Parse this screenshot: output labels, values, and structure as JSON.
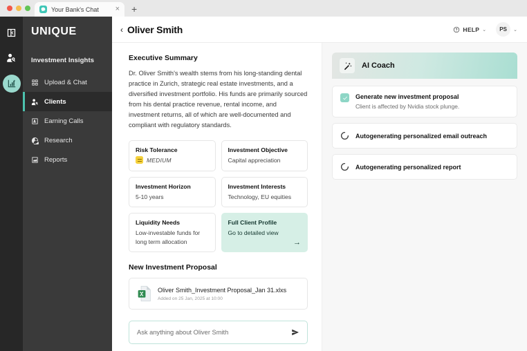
{
  "browser": {
    "tab_title": "Your Bank's Chat",
    "tab_close": "×",
    "new_tab": "+"
  },
  "rail": {
    "items": [
      {
        "icon": "panel-collapse-icon",
        "name": "collapse-panel"
      },
      {
        "icon": "user-search-icon",
        "name": "user-search"
      },
      {
        "icon": "insights-chart-icon",
        "name": "investment-insights",
        "active": true
      }
    ]
  },
  "sidebar": {
    "brand": "UNIQUE",
    "heading": "Investment Insights",
    "items": [
      {
        "label": "Upload & Chat",
        "icon": "grid-upload-icon",
        "active": false
      },
      {
        "label": "Clients",
        "icon": "clients-icon",
        "active": true
      },
      {
        "label": "Earning Calls",
        "icon": "earning-calls-icon",
        "active": false
      },
      {
        "label": "Research",
        "icon": "research-icon",
        "active": false
      },
      {
        "label": "Reports",
        "icon": "reports-icon",
        "active": false
      }
    ]
  },
  "topbar": {
    "back": "‹",
    "title": "Oliver Smith",
    "help_label": "HELP",
    "caret": "⌄",
    "avatar_initials": "PS"
  },
  "summary": {
    "title": "Executive Summary",
    "body": "Dr. Oliver Smith's wealth stems from his long-standing dental practice in Zurich, strategic real estate investments, and a diversified investment portfolio. His funds are primarily sourced from his dental practice revenue, rental income, and investment returns, all of which are well-documented and compliant with regulatory standards."
  },
  "cards": [
    {
      "label": "Risk Tolerance",
      "value": "MEDIUM",
      "badge": true,
      "accent": false
    },
    {
      "label": "Investment Objective",
      "value": "Capital appreciation",
      "badge": false,
      "accent": false
    },
    {
      "label": "Investment Horizon",
      "value": "5-10 years",
      "badge": false,
      "accent": false
    },
    {
      "label": "Investment Interests",
      "value": "Technology, EU equities",
      "badge": false,
      "accent": false
    },
    {
      "label": "Liquidity Needs",
      "value": "Low-investable funds for long term allocation",
      "badge": false,
      "accent": false
    },
    {
      "label": "Full Client Profile",
      "value": "Go to detailed view",
      "badge": false,
      "accent": true,
      "arrow": "→"
    }
  ],
  "proposal": {
    "title": "New Investment Proposal",
    "file_name": "Oliver Smith_Investment Proposal_Jan 31.xlxs",
    "file_meta": "Added on 25 Jan, 2025 at 10:00",
    "file_icon": "excel-file-icon"
  },
  "chat": {
    "placeholder": "Ask anything about Oliver Smith",
    "send_icon": "send-icon"
  },
  "coach": {
    "title": "AI Coach",
    "icon": "magic-wand-icon",
    "tasks": [
      {
        "state": "done",
        "title": "Generate new investment proposal",
        "subtitle": "Client is affected by Nvidia stock plunge."
      },
      {
        "state": "loading",
        "title": "Autogenerating personalized email outreach"
      },
      {
        "state": "loading",
        "title": "Autogenerating personalized report"
      }
    ]
  },
  "colors": {
    "accent_teal": "#4cc2ae",
    "mint_card": "#d6efe6",
    "rail_dark": "#272727",
    "sidebar_dark": "#3a3a3a",
    "risk_yellow": "#f5d13c"
  }
}
